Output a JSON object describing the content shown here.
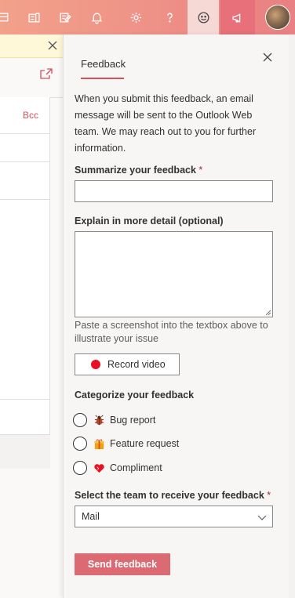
{
  "feedback": {
    "tab_label": "Feedback",
    "intro": "When you submit this feedback, an email message will be sent to the Outlook Web team. We may reach out to you for further information.",
    "summary_label": "Summarize your feedback",
    "required_mark": "*",
    "summary_value": "",
    "detail_label": "Explain in more detail (optional)",
    "detail_value": "",
    "paste_hint": "Paste a screenshot into the textbox above to illustrate your issue",
    "record_label": "Record video",
    "categorize_label": "Categorize your feedback",
    "categories": [
      {
        "label": "Bug report",
        "icon": "bug-icon",
        "color": "#b7472a"
      },
      {
        "label": "Feature request",
        "icon": "gift-icon",
        "color": "#f0a30a"
      },
      {
        "label": "Compliment",
        "icon": "heart-icon",
        "color": "#e81123"
      }
    ],
    "team_label": "Select the team to receive your feedback",
    "team_selected": "Mail",
    "send_label": "Send feedback"
  },
  "compose": {
    "bcc_label": "Bcc"
  },
  "colors": {
    "accent": "#d6525b",
    "send_button": "#db6a72",
    "record_dot": "#e81123"
  }
}
